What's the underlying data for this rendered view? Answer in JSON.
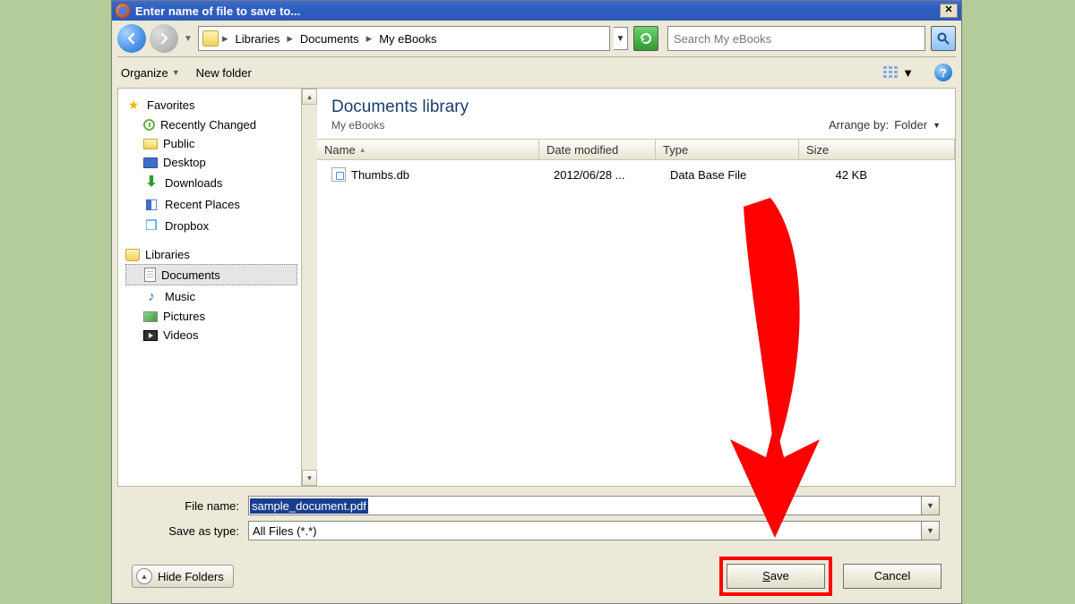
{
  "title": "Enter name of file to save to...",
  "breadcrumb": {
    "root_sep": "▸",
    "p1": "Libraries",
    "p2": "Documents",
    "p3": "My eBooks"
  },
  "search": {
    "placeholder": "Search My eBooks"
  },
  "toolbar": {
    "organize": "Organize",
    "newfolder": "New folder"
  },
  "sidebar": {
    "favorites": "Favorites",
    "items_fav": {
      "recent": "Recently Changed",
      "public": "Public",
      "desktop": "Desktop",
      "downloads": "Downloads",
      "places": "Recent Places",
      "dropbox": "Dropbox"
    },
    "libraries": "Libraries",
    "items_lib": {
      "documents": "Documents",
      "music": "Music",
      "pictures": "Pictures",
      "videos": "Videos"
    }
  },
  "content": {
    "heading": "Documents library",
    "sub": "My eBooks",
    "arrange_label": "Arrange by:",
    "arrange_value": "Folder",
    "cols": {
      "name": "Name",
      "date": "Date modified",
      "type": "Type",
      "size": "Size"
    },
    "rows": [
      {
        "name": "Thumbs.db",
        "date": "2012/06/28 ...",
        "type": "Data Base File",
        "size": "42 KB"
      }
    ]
  },
  "form": {
    "filename_label": "File name:",
    "filename_value": "sample_document.pdf",
    "saveas_label": "Save as type:",
    "saveas_value": "All Files (*.*)"
  },
  "footer": {
    "hide": "Hide Folders",
    "save": "Save",
    "cancel": "Cancel"
  }
}
